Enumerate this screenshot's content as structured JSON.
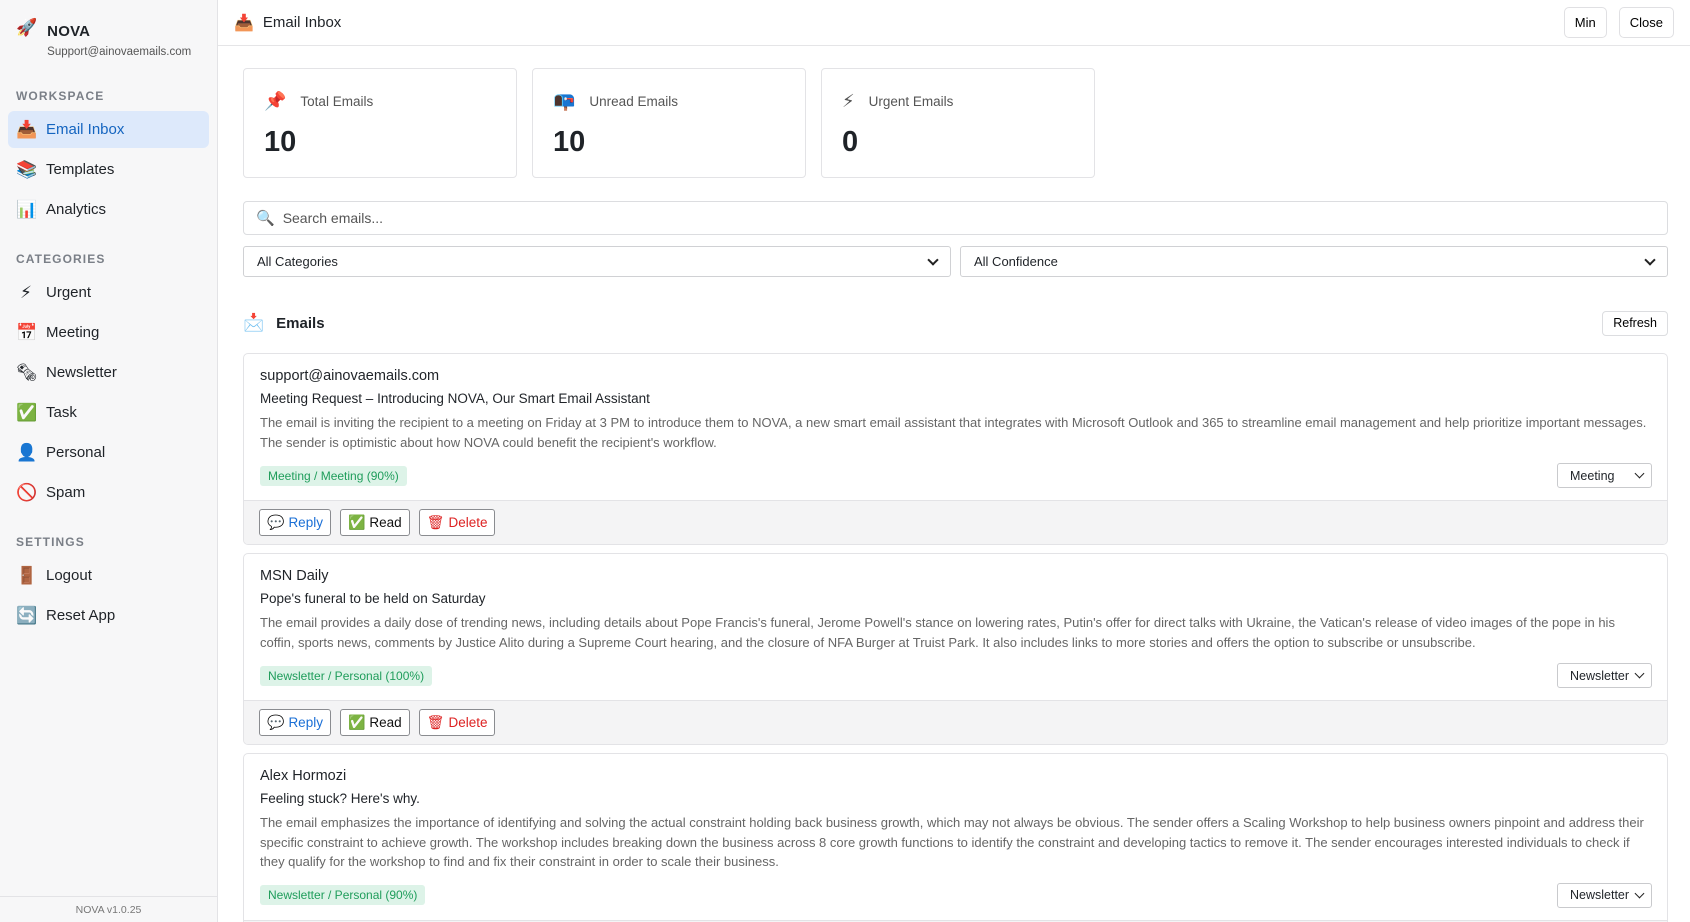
{
  "brand": {
    "name": "NOVA",
    "email": "Support@ainovaemails.com",
    "icon": "rocket-icon"
  },
  "sidebar": {
    "workspace_title": "WORKSPACE",
    "workspace": [
      {
        "label": "Email Inbox",
        "icon": "📥",
        "active": true
      },
      {
        "label": "Templates",
        "icon": "📚"
      },
      {
        "label": "Analytics",
        "icon": "📊"
      }
    ],
    "categories_title": "CATEGORIES",
    "categories": [
      {
        "label": "Urgent",
        "icon": "⚡"
      },
      {
        "label": "Meeting",
        "icon": "📅"
      },
      {
        "label": "Newsletter",
        "icon": "🗞"
      },
      {
        "label": "Task",
        "icon": "✅"
      },
      {
        "label": "Personal",
        "icon": "👤"
      },
      {
        "label": "Spam",
        "icon": "🚫"
      }
    ],
    "settings_title": "SETTINGS",
    "settings": [
      {
        "label": "Logout",
        "icon": "🚪"
      },
      {
        "label": "Reset App",
        "icon": "🔄"
      }
    ],
    "version": "NOVA v1.0.25"
  },
  "topbar": {
    "title": "Email Inbox",
    "min_label": "Min",
    "close_label": "Close"
  },
  "stats": [
    {
      "label": "Total Emails",
      "value": "10",
      "icon": "📌"
    },
    {
      "label": "Unread Emails",
      "value": "10",
      "icon": "📭"
    },
    {
      "label": "Urgent Emails",
      "value": "0",
      "icon": "⚡"
    }
  ],
  "search": {
    "placeholder": "Search emails..."
  },
  "filters": {
    "category": "All Categories",
    "confidence": "All Confidence"
  },
  "list": {
    "title": "Emails",
    "refresh_label": "Refresh"
  },
  "actions": {
    "reply": "Reply",
    "read": "Read",
    "delete": "Delete"
  },
  "emails": [
    {
      "from": "support@ainovaemails.com",
      "subject": "Meeting Request – Introducing NOVA, Our Smart Email Assistant",
      "summary": "The email is inviting the recipient to a meeting on Friday at 3 PM to introduce them to NOVA, a new smart email assistant that integrates with Microsoft Outlook and 365 to streamline email management and help prioritize important messages. The sender is optimistic about how NOVA could benefit the recipient's workflow.",
      "tag": "Meeting / Meeting (90%)",
      "category": "Meeting"
    },
    {
      "from": "MSN Daily",
      "subject": "Pope's funeral to be held on Saturday",
      "summary": "The email provides a daily dose of trending news, including details about Pope Francis's funeral, Jerome Powell's stance on lowering rates, Putin's offer for direct talks with Ukraine, the Vatican's release of video images of the pope in his coffin, sports news, comments by Justice Alito during a Supreme Court hearing, and the closure of NFA Burger at Truist Park. It also includes links to more stories and offers the option to subscribe or unsubscribe.",
      "tag": "Newsletter / Personal (100%)",
      "category": "Newsletter"
    },
    {
      "from": "Alex Hormozi",
      "subject": "Feeling stuck? Here's why.",
      "summary": "The email emphasizes the importance of identifying and solving the actual constraint holding back business growth, which may not always be obvious. The sender offers a Scaling Workshop to help business owners pinpoint and address their specific constraint to achieve growth. The workshop includes breaking down the business across 8 core growth functions to identify the constraint and developing tactics to remove it. The sender encourages interested individuals to check if they qualify for the workshop to find and fix their constraint in order to scale their business.",
      "tag": "Newsletter / Personal (90%)",
      "category": "Newsletter"
    }
  ]
}
